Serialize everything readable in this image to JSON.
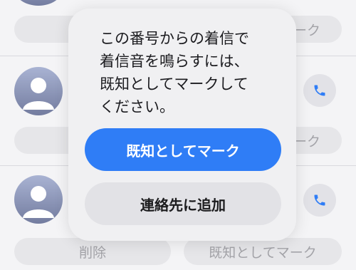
{
  "background": {
    "delete_label": "削除",
    "mark_known_label": "既知としてマーク",
    "mark_known_partial": "マーク",
    "mark_known_partial_short": "ーク"
  },
  "dialog": {
    "message": "この番号からの着信で\n着信音を鳴らすには、\n既知としてマークして\nください。",
    "primary_button": "既知としてマーク",
    "secondary_button": "連絡先に追加"
  },
  "colors": {
    "accent": "#2f7df6",
    "call_icon": "#2f7df6",
    "dialog_bg": "#f0f0f2"
  },
  "icons": {
    "avatar": "person-silhouette-icon",
    "call": "phone-icon"
  }
}
